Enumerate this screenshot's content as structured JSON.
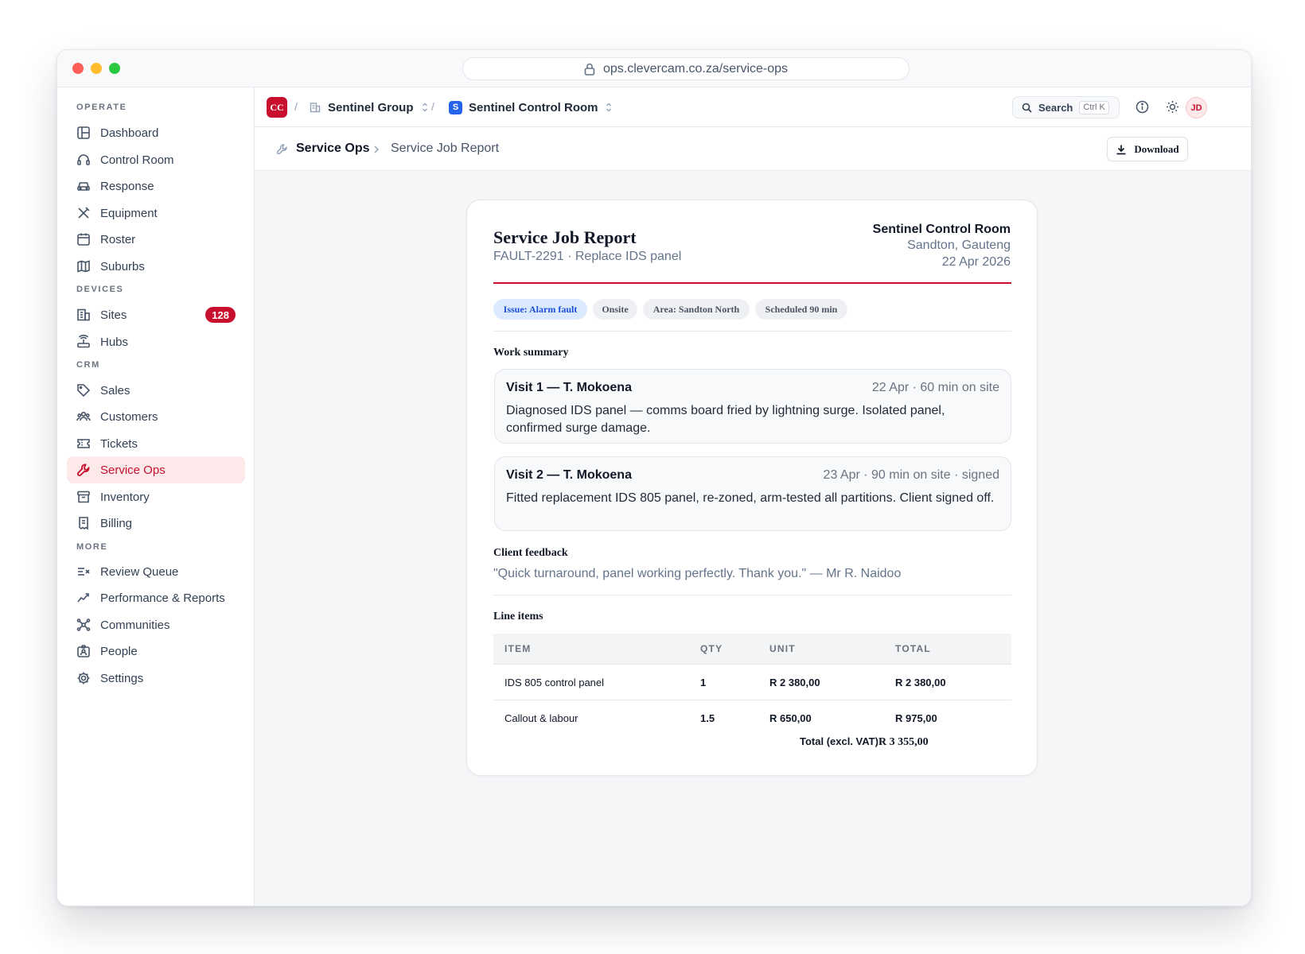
{
  "browser": {
    "url": "ops.clevercam.co.za/service-ops"
  },
  "topbar": {
    "logo_text": "CC",
    "org": "Sentinel Group",
    "workspace_initial": "S",
    "workspace": "Sentinel Control Room",
    "search_label": "Search",
    "search_shortcut": "Ctrl K",
    "user_initials": "JD"
  },
  "breadcrumb": {
    "section": "Service Ops",
    "page": "Service Job Report",
    "download_label": "Download"
  },
  "sidebar": {
    "sections": {
      "operate": "OPERATE",
      "devices": "DEVICES",
      "crm": "CRM",
      "more": "MORE"
    },
    "items": [
      {
        "label": "Dashboard",
        "icon": "dashboard-icon"
      },
      {
        "label": "Control Room",
        "icon": "headset-icon"
      },
      {
        "label": "Response",
        "icon": "car-icon"
      },
      {
        "label": "Equipment",
        "icon": "tools-icon"
      },
      {
        "label": "Roster",
        "icon": "calendar-icon"
      },
      {
        "label": "Suburbs",
        "icon": "map-icon"
      },
      {
        "label": "Sites",
        "icon": "building-icon",
        "badge": "128"
      },
      {
        "label": "Hubs",
        "icon": "router-icon"
      },
      {
        "label": "Sales",
        "icon": "tag-icon"
      },
      {
        "label": "Customers",
        "icon": "users-icon"
      },
      {
        "label": "Tickets",
        "icon": "ticket-icon"
      },
      {
        "label": "Service Ops",
        "icon": "wrench-icon",
        "active": true
      },
      {
        "label": "Inventory",
        "icon": "archive-icon"
      },
      {
        "label": "Billing",
        "icon": "receipt-icon"
      },
      {
        "label": "Review Queue",
        "icon": "review-list-icon"
      },
      {
        "label": "Performance & Reports",
        "icon": "trend-icon"
      },
      {
        "label": "Communities",
        "icon": "network-icon"
      },
      {
        "label": "People",
        "icon": "id-badge-icon"
      },
      {
        "label": "Settings",
        "icon": "gear-icon"
      }
    ]
  },
  "report": {
    "title": "Service Job Report",
    "subtitle": "FAULT-2291 · Replace IDS panel",
    "company": "Sentinel Control Room",
    "location": "Sandton, Gauteng",
    "date": "22 Apr 2026",
    "accent_color": "#c8102e",
    "chips": [
      "Issue: Alarm fault",
      "Onsite",
      "Area: Sandton North",
      "Scheduled 90 min"
    ],
    "work_summary_heading": "Work summary",
    "visits": [
      {
        "title": "Visit 1 — T. Mokoena",
        "meta": "22 Apr · 60 min on site",
        "body": "Diagnosed IDS panel — comms board fried by lightning surge. Isolated panel, confirmed surge damage."
      },
      {
        "title": "Visit 2 — T. Mokoena",
        "meta": "23 Apr · 90 min on site · signed",
        "body": "Fitted replacement IDS 805 panel, re-zoned, arm-tested all partitions. Client signed off."
      }
    ],
    "feedback_heading": "Client feedback",
    "feedback": "\"Quick turnaround, panel working perfectly. Thank you.\" — Mr R. Naidoo",
    "line_items_heading": "Line items",
    "columns": [
      "ITEM",
      "QTY",
      "UNIT",
      "TOTAL"
    ],
    "rows": [
      {
        "item": "IDS 805 control panel",
        "qty": "1",
        "unit": "R 2 380,00",
        "total": "R 2 380,00"
      },
      {
        "item": "Callout & labour",
        "qty": "1.5",
        "unit": "R 650,00",
        "total": "R 975,00"
      }
    ],
    "total_label": "Total (excl. VAT)",
    "total_value": "R 3 355,00"
  }
}
